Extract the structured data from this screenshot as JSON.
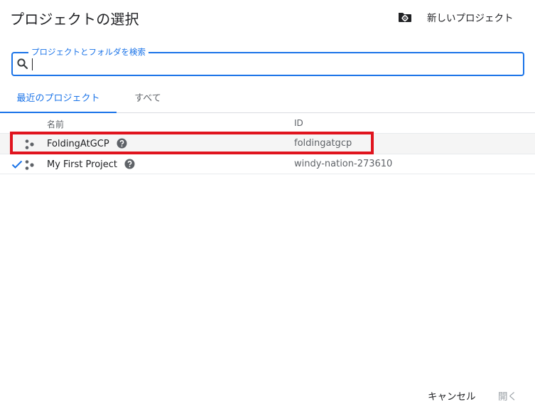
{
  "dialog": {
    "title": "プロジェクトの選択",
    "new_project_label": "新しいプロジェクト"
  },
  "search": {
    "label": "プロジェクトとフォルダを検索",
    "value": "",
    "placeholder": ""
  },
  "tabs": [
    {
      "label": "最近のプロジェクト",
      "active": true
    },
    {
      "label": "すべて",
      "active": false
    }
  ],
  "table": {
    "columns": [
      "名前",
      "ID"
    ],
    "rows": [
      {
        "name": "FoldingAtGCP",
        "id": "foldingatgcp",
        "selected": false,
        "highlighted": true
      },
      {
        "name": "My First Project",
        "id": "windy-nation-273610",
        "selected": true,
        "highlighted": false
      }
    ]
  },
  "footer": {
    "cancel_label": "キャンセル",
    "open_label": "開く"
  },
  "colors": {
    "accent": "#1a73e8",
    "highlight_box": "#e0141e",
    "row_hover": "#f5f5f5"
  }
}
